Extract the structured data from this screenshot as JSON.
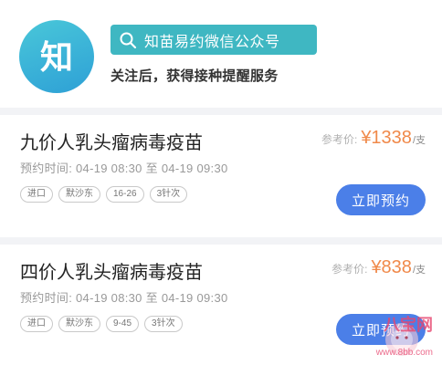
{
  "header": {
    "logo_text": "知",
    "search_label": "知苗易约微信公众号",
    "subtitle": "关注后，获得接种提醒服务"
  },
  "vaccines": [
    {
      "name": "九价人乳头瘤病毒疫苗",
      "price_label": "参考价:",
      "price": "¥1338",
      "price_unit": "/支",
      "time": "预约时间: 04-19 08:30 至 04-19 09:30",
      "tags": [
        "进口",
        "默沙东",
        "16-26",
        "3针次"
      ],
      "button": "立即预约"
    },
    {
      "name": "四价人乳头瘤病毒疫苗",
      "price_label": "参考价:",
      "price": "¥838",
      "price_unit": "/支",
      "time": "预约时间: 04-19 08:30 至 04-19 09:30",
      "tags": [
        "进口",
        "默沙东",
        "9-45",
        "3针次"
      ],
      "button": "立即预约"
    }
  ],
  "watermark": {
    "text": "八宝网",
    "url": "www.8bb.com"
  },
  "colors": {
    "logo": "#3bb4d8",
    "search_pill": "#3fb7c2",
    "price": "#f0894a",
    "button": "#4b7fe8"
  },
  "icons": {
    "search": "search-icon",
    "logo": "zhimiao-logo"
  }
}
